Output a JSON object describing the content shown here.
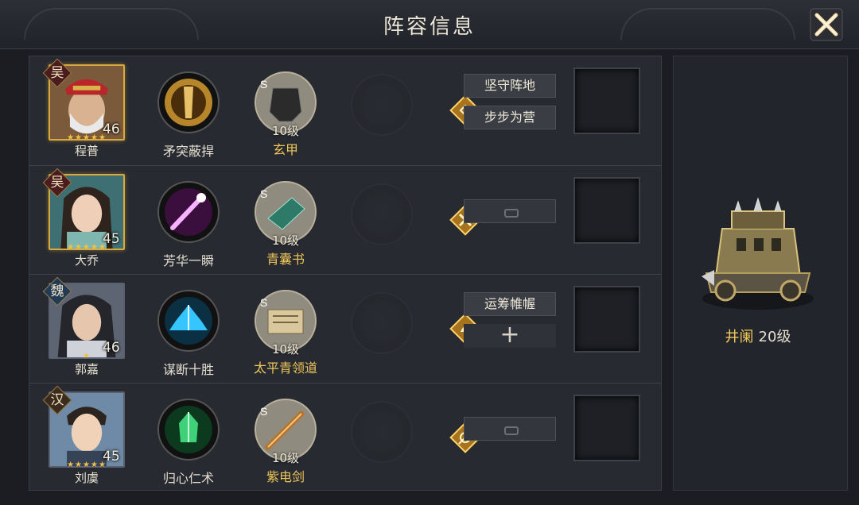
{
  "title": "阵容信息",
  "close_icon": "close-x-icon",
  "heroes": [
    {
      "faction": "吴",
      "level": "46",
      "stars": "★★★★★",
      "name": "程普",
      "skill": "矛突蔽捍",
      "item_grade": "S",
      "item_level": "10级",
      "item_name": "玄甲",
      "tags": [
        "坚守阵地",
        "步步为营"
      ]
    },
    {
      "faction": "吴",
      "level": "45",
      "stars": "★★★★★",
      "name": "大乔",
      "skill": "芳华一瞬",
      "item_grade": "S",
      "item_level": "10级",
      "item_name": "青囊书",
      "tags": []
    },
    {
      "faction": "魏",
      "level": "46",
      "stars": "★",
      "name": "郭嘉",
      "skill": "谋断十胜",
      "item_grade": "S",
      "item_level": "10级",
      "item_name": "太平青领道",
      "tags": [
        "运筹帷幄"
      ],
      "add": "+"
    },
    {
      "faction": "汉",
      "level": "45",
      "stars": "★★★★★",
      "name": "刘虞",
      "skill": "归心仁术",
      "item_grade": "S",
      "item_level": "10级",
      "item_name": "紫电剑",
      "tags": []
    }
  ],
  "vehicle": {
    "name": "井阑",
    "level": "20级"
  },
  "colors": {
    "accent_gold": "#d8a93b",
    "panel": "#272a31"
  }
}
